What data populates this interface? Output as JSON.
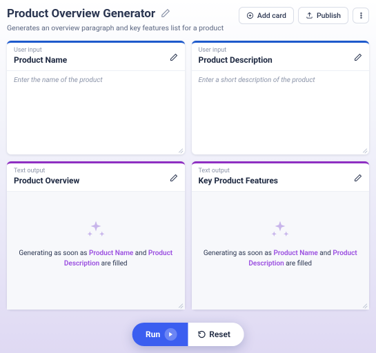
{
  "header": {
    "title": "Product Overview Generator",
    "subtitle": "Generates an overview paragraph and key features list for a product",
    "add_card_label": "Add card",
    "publish_label": "Publish"
  },
  "cards": {
    "name": {
      "type_label": "User input",
      "title": "Product Name",
      "placeholder": "Enter the name of the product"
    },
    "description": {
      "type_label": "User input",
      "title": "Product Description",
      "placeholder": "Enter a short description of the product"
    },
    "overview": {
      "type_label": "Text output",
      "title": "Product Overview",
      "gen_prefix": "Generating as soon as ",
      "ref1": "Product Name",
      "and": " and ",
      "ref2": "Product Description",
      "suffix": " are filled"
    },
    "features": {
      "type_label": "Text output",
      "title": "Key Product Features",
      "gen_prefix": "Generating as soon as ",
      "ref1": "Product Name",
      "and": " and ",
      "ref2": "Product Description",
      "suffix": " are filled"
    }
  },
  "footer": {
    "run_label": "Run",
    "reset_label": "Reset"
  }
}
